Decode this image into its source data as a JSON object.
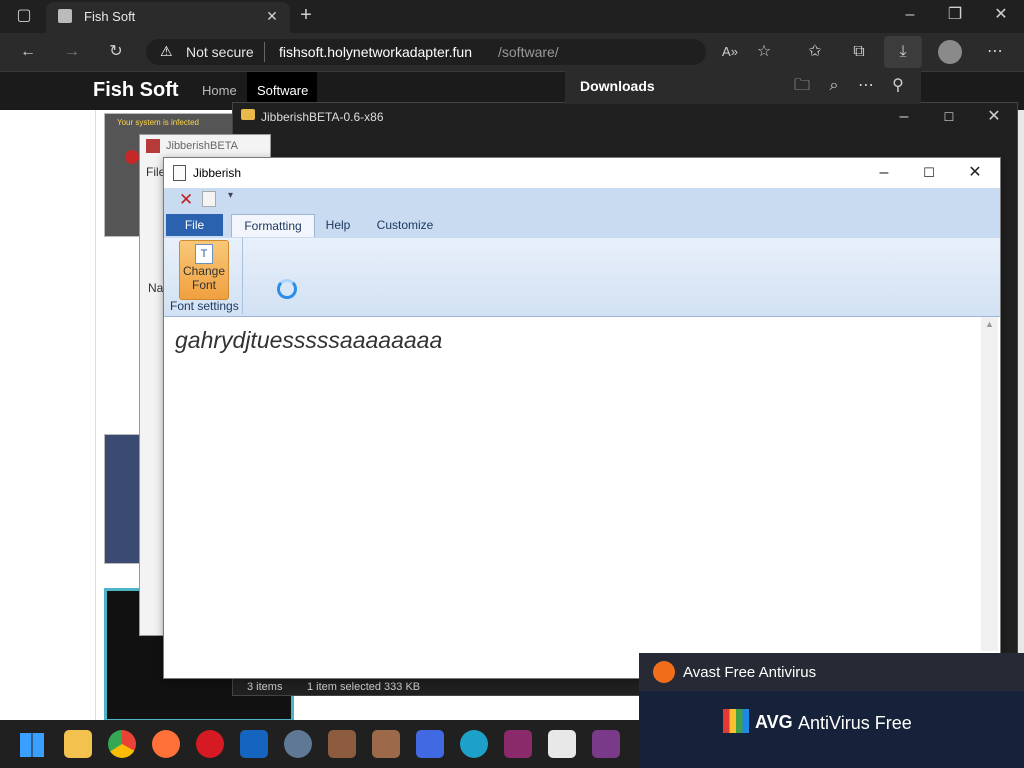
{
  "browser": {
    "tab_title": "Fish Soft",
    "security_label": "Not secure",
    "url_host": "fishsoft.holynetworkadapter.fun",
    "url_path": "/software/"
  },
  "site": {
    "brand": "Fish Soft",
    "nav": [
      {
        "label": "Home"
      },
      {
        "label": "Software"
      }
    ],
    "popup_caption": "Your system is infected"
  },
  "downloads": {
    "title": "Downloads"
  },
  "explorer": {
    "title": "JibberishBETA-0.6-x86",
    "back_title": "JibberishBETA",
    "file_menu": "File",
    "name_col": "Nar",
    "status_items": "3 items",
    "status_selected": "1 item selected  333 KB"
  },
  "jibberish": {
    "title": "Jibberish",
    "tabs": [
      {
        "label": "File"
      },
      {
        "label": "Formatting"
      },
      {
        "label": "Help"
      },
      {
        "label": "Customize"
      }
    ],
    "change_font_label1": "Change",
    "change_font_label2": "Font",
    "group_label": "Font settings",
    "editor_text": "gahrydjtuesssssaaaaaaaa"
  },
  "notifications": {
    "avast": "Avast Free Antivirus",
    "avg_brand": "AVG",
    "avg_name": "AntiVirus Free"
  },
  "colors": {
    "accent": "#1a6fc4",
    "avast_orange": "#f06d1a",
    "button_orange": "#f0a040"
  }
}
